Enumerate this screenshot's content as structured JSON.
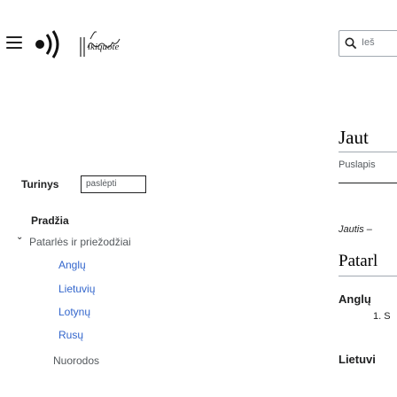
{
  "header": {
    "logo_text": "Vikipedija",
    "search_placeholder": "Ieš"
  },
  "sidebar": {
    "contents_label": "Turinys",
    "hide_button": "paslėpti",
    "items": {
      "start": "Pradžia",
      "section": "Patarlės ir priežodžiai",
      "sub": [
        "Anglų",
        "Lietuvių",
        "Lotynų",
        "Rusų"
      ],
      "refs": "Nuorodos"
    }
  },
  "article": {
    "title": "Jaut",
    "page_tab": "Puslapis",
    "subtitle": "Jautis –",
    "section_heading": "Patarl",
    "lang_heading": "Anglų",
    "item_number": "1. S",
    "lang_heading2": "Lietuvi"
  }
}
